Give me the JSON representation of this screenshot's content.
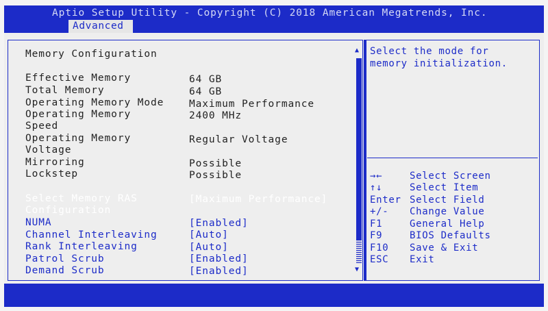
{
  "header": {
    "title": "Aptio Setup Utility - Copyright (C) 2018 American Megatrends, Inc.",
    "active_tab": "Advanced"
  },
  "section_title": "Memory Configuration",
  "info_rows": [
    {
      "label": "Effective Memory",
      "value": "64 GB"
    },
    {
      "label": "Total Memory",
      "value": "64 GB"
    },
    {
      "label": "Operating Memory Mode",
      "value": "Maximum Performance"
    },
    {
      "label": "Operating Memory\nSpeed",
      "value": "2400 MHz"
    },
    {
      "label": "Operating Memory\nVoltage",
      "value": "Regular Voltage"
    },
    {
      "label": "Mirroring",
      "value": "Possible"
    },
    {
      "label": "Lockstep",
      "value": "Possible"
    }
  ],
  "settings": [
    {
      "label": "Select Memory RAS\nConfiguration",
      "value": "[Maximum Performance]",
      "selected": true
    },
    {
      "label": "NUMA",
      "value": "[Enabled]"
    },
    {
      "label": "Channel Interleaving",
      "value": "[Auto]"
    },
    {
      "label": "Rank Interleaving",
      "value": "[Auto]"
    },
    {
      "label": "Patrol Scrub",
      "value": "[Enabled]"
    },
    {
      "label": "Demand Scrub",
      "value": "[Enabled]"
    }
  ],
  "help": {
    "text": "Select the mode for\nmemory initialization."
  },
  "key_legend": [
    {
      "key": "→←",
      "desc": "Select Screen"
    },
    {
      "key": "↑↓",
      "desc": "Select Item"
    },
    {
      "key": "Enter",
      "desc": "Select Field"
    },
    {
      "key": "+/-",
      "desc": "Change Value"
    },
    {
      "key": "F1",
      "desc": "General Help"
    },
    {
      "key": "F9",
      "desc": "BIOS Defaults"
    },
    {
      "key": "F10",
      "desc": "Save & Exit"
    },
    {
      "key": "ESC",
      "desc": "Exit"
    }
  ],
  "colors": {
    "bios_blue": "#1c2bc8",
    "panel_gray": "#eeeeee",
    "selected_text": "#ffffff"
  }
}
